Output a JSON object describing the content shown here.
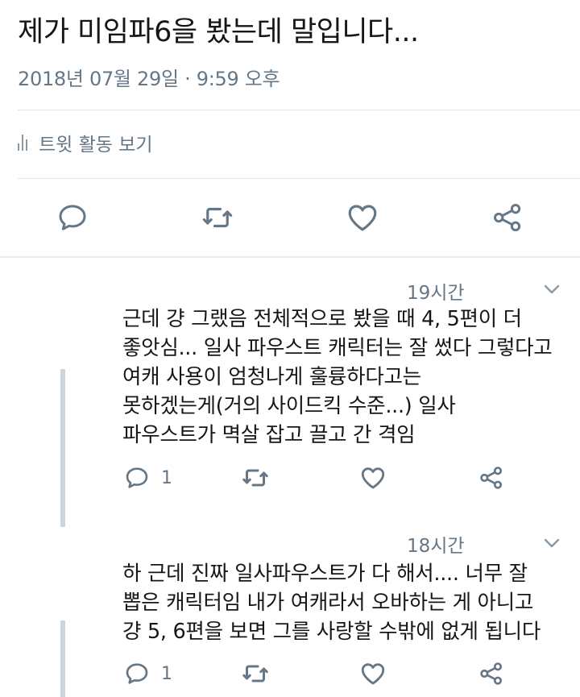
{
  "tweet": {
    "text": "제가 미임파6을 봤는데 말입니다...",
    "timestamp": "2018년 07월 29일 · 9:59 오후",
    "activity_label": "트윗 활동 보기"
  },
  "actions": {
    "reply_icon": "reply-icon",
    "retweet_icon": "retweet-icon",
    "like_icon": "heart-icon",
    "share_icon": "share-icon"
  },
  "replies": [
    {
      "time": "19시간",
      "text": "근데 걍 그랬음 전체적으로 봤을 때 4, 5편이 더\n좋앗심... 일사 파우스트 캐릭터는 잘 썼다 그렇다고\n여캐 사용이 엄청나게 훌륭하다고는\n못하겠는게(거의 사이드킥 수준...) 일사\n파우스트가 멱살 잡고 끌고 간 격임",
      "reply_count": "1"
    },
    {
      "time": "18시간",
      "text": "하 근데 진짜 일사파우스트가 다 해서.... 너무 잘\n뽑은 캐릭터임 내가 여캐라서 오바하는 게 아니고\n걍 5, 6편을 보면 그를 사랑할 수밖에 없게 됩니다",
      "reply_count": "1"
    }
  ],
  "colors": {
    "text": "#14171a",
    "secondary": "#657786",
    "divider": "#e1e8ed",
    "thread_line": "#ccd6dd"
  }
}
